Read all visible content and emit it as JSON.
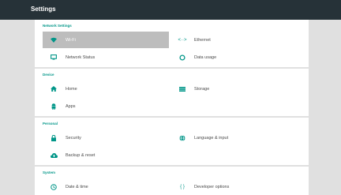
{
  "header": {
    "title": "Settings"
  },
  "colors": {
    "accent": "#009688",
    "topbar": "#263238",
    "highlight": "#bdbdbd"
  },
  "sections": [
    {
      "header": "Network Settings",
      "items": [
        {
          "label": "Wi-Fi",
          "icon": "wifi-icon",
          "selected": true
        },
        {
          "label": "Ethernet",
          "icon": "ethernet-icon"
        },
        {
          "label": "Network Status",
          "icon": "monitor-icon"
        },
        {
          "label": "Data usage",
          "icon": "data-usage-icon"
        }
      ]
    },
    {
      "header": "Device",
      "items": [
        {
          "label": "Home",
          "icon": "home-icon"
        },
        {
          "label": "Storage",
          "icon": "storage-icon"
        },
        {
          "label": "Apps",
          "icon": "android-icon"
        }
      ]
    },
    {
      "header": "Personal",
      "items": [
        {
          "label": "Security",
          "icon": "lock-icon"
        },
        {
          "label": "Language & input",
          "icon": "globe-icon"
        },
        {
          "label": "Backup & reset",
          "icon": "cloud-upload-icon"
        }
      ]
    },
    {
      "header": "System",
      "items": [
        {
          "label": "Date & time",
          "icon": "clock-icon"
        },
        {
          "label": "Developer options",
          "icon": "code-icon"
        }
      ]
    }
  ]
}
